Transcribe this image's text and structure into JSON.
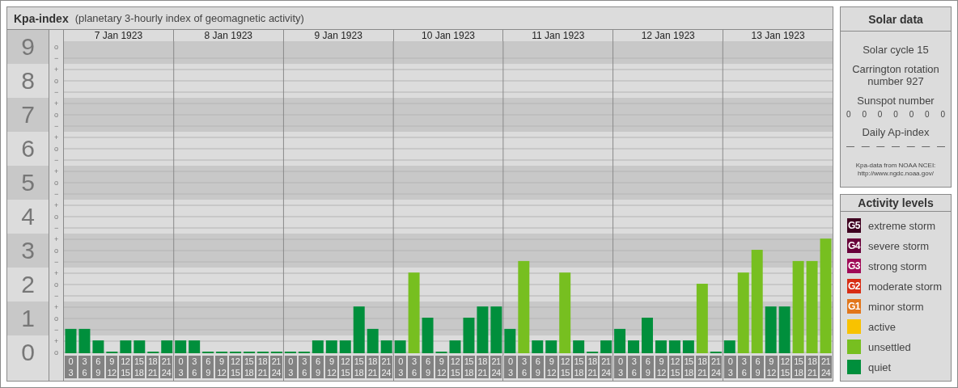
{
  "main": {
    "title": "Kpa-index",
    "subtitle": "(planetary 3-hourly index of geomagnetic activity)"
  },
  "scale": [
    {
      "marks": [
        "o",
        "−"
      ]
    },
    {
      "marks": [
        "+",
        "o",
        "−"
      ]
    },
    {
      "marks": [
        "+",
        "o",
        "−"
      ]
    },
    {
      "marks": [
        "+",
        "o",
        "−"
      ]
    },
    {
      "marks": [
        "+",
        "o",
        "−"
      ]
    },
    {
      "marks": [
        "+",
        "o",
        "−"
      ]
    },
    {
      "marks": [
        "+",
        "o",
        "−"
      ]
    },
    {
      "marks": [
        "+",
        "o",
        "−"
      ]
    },
    {
      "marks": [
        "+",
        "o",
        "−"
      ]
    },
    {
      "marks": [
        "+",
        "o"
      ]
    }
  ],
  "days": [
    {
      "date": "7 Jan 1923"
    },
    {
      "date": "8 Jan 1923"
    },
    {
      "date": "9 Jan 1923"
    },
    {
      "date": "10 Jan 1923"
    },
    {
      "date": "11 Jan 1923"
    },
    {
      "date": "12 Jan 1923"
    },
    {
      "date": "13 Jan 1923"
    }
  ],
  "chart_data": {
    "type": "bar",
    "grid": true,
    "ylim": [
      0,
      9.17
    ],
    "yticks": [
      {
        "value": 9,
        "label": "9"
      },
      {
        "value": 8,
        "label": "8"
      },
      {
        "value": 7,
        "label": "7"
      },
      {
        "value": 6,
        "label": "6"
      },
      {
        "value": 5,
        "label": "5"
      },
      {
        "value": 4,
        "label": "4"
      },
      {
        "value": 3,
        "label": "3"
      },
      {
        "value": 2,
        "label": "2"
      },
      {
        "value": 1,
        "label": "1"
      },
      {
        "value": 0,
        "label": "0"
      }
    ],
    "categories": [
      "0\n3",
      "3\n6",
      "6\n9",
      "9\n12",
      "12\n15",
      "15\n18",
      "18\n21",
      "21\n24",
      "0\n3",
      "3\n6",
      "6\n9",
      "9\n12",
      "12\n15",
      "15\n18",
      "18\n21",
      "21\n24",
      "0\n3",
      "3\n6",
      "6\n9",
      "9\n12",
      "12\n15",
      "15\n18",
      "18\n21",
      "21\n24",
      "0\n3",
      "3\n6",
      "6\n9",
      "9\n12",
      "12\n15",
      "15\n18",
      "18\n21",
      "21\n24",
      "0\n3",
      "3\n6",
      "6\n9",
      "9\n12",
      "12\n15",
      "15\n18",
      "18\n21",
      "21\n24",
      "0\n3",
      "3\n6",
      "6\n9",
      "9\n12",
      "12\n15",
      "15\n18",
      "18\n21",
      "21\n24",
      "0\n3",
      "3\n6",
      "6\n9",
      "9\n12",
      "12\n15",
      "15\n18",
      "18\n21",
      "21\n24"
    ],
    "series": [
      {
        "color": "#008f3c",
        "values": [
          0.67,
          0.67,
          0.33,
          0,
          0.33,
          0.33,
          0,
          0.33,
          0.33,
          0.33,
          0,
          0,
          0,
          0,
          0,
          0,
          0,
          0,
          0.33,
          0.33,
          0.33,
          1.33,
          0.67,
          0.33,
          0.33,
          null,
          1,
          0,
          0.33,
          1,
          1.33,
          1.33,
          0.67,
          null,
          0.33,
          0.33,
          null,
          0.33,
          0,
          0.33,
          0.67,
          0.33,
          1,
          0.33,
          0.33,
          0.33,
          null,
          0,
          0.33,
          null,
          null,
          1.33,
          1.33,
          null,
          null,
          null
        ]
      },
      {
        "color": "#77bf20",
        "values": [
          null,
          null,
          null,
          null,
          null,
          null,
          null,
          null,
          null,
          null,
          null,
          null,
          null,
          null,
          null,
          null,
          null,
          null,
          null,
          null,
          null,
          null,
          null,
          null,
          null,
          2.33,
          null,
          null,
          null,
          null,
          null,
          null,
          null,
          2.67,
          null,
          null,
          2.33,
          null,
          null,
          null,
          null,
          null,
          null,
          null,
          null,
          null,
          2,
          null,
          null,
          2.33,
          3,
          null,
          null,
          2.67,
          2.67,
          3.33
        ]
      }
    ]
  },
  "solar": {
    "title": "Solar data",
    "cycle": "Solar cycle 15",
    "rotation": "Carrington rotation number 927",
    "sunspot_label": "Sunspot number",
    "sunspots": [
      "0",
      "0",
      "0",
      "0",
      "0",
      "0",
      "0"
    ],
    "ap_label": "Daily Ap-index",
    "ap": [
      "—",
      "—",
      "—",
      "—",
      "—",
      "—",
      "—"
    ],
    "source": "Kpa-data from NOAA NCEI:",
    "source_url": "http://www.ngdc.noaa.gov/"
  },
  "legend": {
    "title": "Activity levels",
    "items": [
      {
        "code": "G5",
        "label": "extreme storm",
        "color": "#3e0020"
      },
      {
        "code": "G4",
        "label": "severe storm",
        "color": "#68003a"
      },
      {
        "code": "G3",
        "label": "strong storm",
        "color": "#a00a58"
      },
      {
        "code": "G2",
        "label": "moderate storm",
        "color": "#d82c14"
      },
      {
        "code": "G1",
        "label": "minor storm",
        "color": "#e2761a"
      },
      {
        "label": "active",
        "color": "#f8c200"
      },
      {
        "label": "unsettled",
        "color": "#77bf20"
      },
      {
        "label": "quiet",
        "color": "#008f3c"
      }
    ]
  }
}
